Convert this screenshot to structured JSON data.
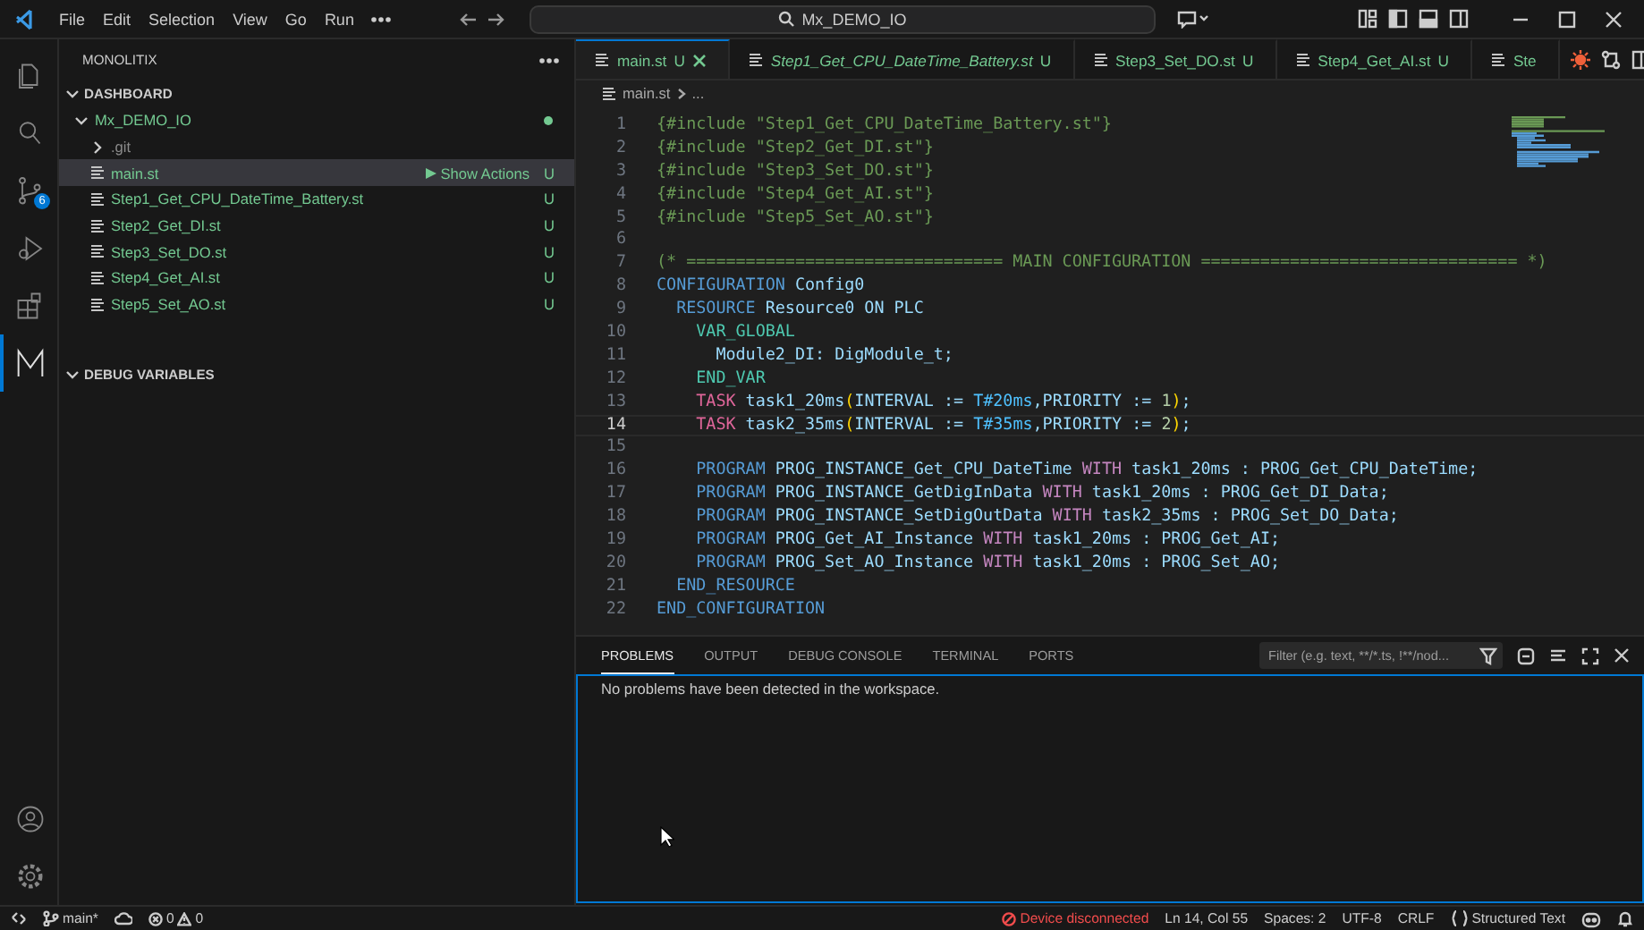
{
  "title_bar": {
    "menus": [
      "File",
      "Edit",
      "Selection",
      "View",
      "Go",
      "Run"
    ],
    "search": "Mx_DEMO_IO"
  },
  "activity_bar": {
    "items": [
      {
        "kind": "files",
        "selected": false
      },
      {
        "kind": "search",
        "selected": false
      },
      {
        "kind": "source-control",
        "selected": false,
        "badge": "6"
      },
      {
        "kind": "run",
        "selected": false
      },
      {
        "kind": "extensions",
        "selected": false
      },
      {
        "kind": "monolitix",
        "selected": true
      }
    ],
    "bottom": [
      {
        "kind": "account"
      },
      {
        "kind": "settings"
      }
    ]
  },
  "sidebar": {
    "title": "MONOLITIX",
    "sections": [
      {
        "title": "DASHBOARD",
        "expanded": true,
        "tree": [
          {
            "name": "Mx_DEMO_IO",
            "kind": "folder",
            "expanded": true,
            "selected": false,
            "dot": true,
            "children": [
              {
                "name": ".git",
                "kind": "folder",
                "expanded": false,
                "selected": false
              },
              {
                "name": "main.st",
                "kind": "file",
                "selected": true,
                "action": "Show Actions",
                "status": "U"
              },
              {
                "name": "Step1_Get_CPU_DateTime_Battery.st",
                "kind": "file",
                "selected": false,
                "status": "U"
              },
              {
                "name": "Step2_Get_DI.st",
                "kind": "file",
                "selected": false,
                "status": "U"
              },
              {
                "name": "Step3_Set_DO.st",
                "kind": "file",
                "selected": false,
                "status": "U"
              },
              {
                "name": "Step4_Get_AI.st",
                "kind": "file",
                "selected": false,
                "status": "U"
              },
              {
                "name": "Step5_Set_AO.st",
                "kind": "file",
                "selected": false,
                "status": "U"
              }
            ]
          }
        ]
      },
      {
        "title": "DEBUG VARIABLES",
        "expanded": true
      }
    ]
  },
  "editor": {
    "tabs": [
      {
        "label": "main.st",
        "status": "U",
        "selected": true,
        "preview": false
      },
      {
        "label": "Step1_Get_CPU_DateTime_Battery.st",
        "status": "U",
        "selected": false,
        "preview": true
      },
      {
        "label": "Step3_Set_DO.st",
        "status": "U",
        "selected": false,
        "preview": false
      },
      {
        "label": "Step4_Get_AI.st",
        "status": "U",
        "selected": false,
        "preview": false
      },
      {
        "label": "Ste",
        "selected": false,
        "preview": false
      }
    ],
    "breadcrumb": [
      "main.st",
      "..."
    ],
    "lines": [
      {
        "n": "1",
        "current": false,
        "tokens": [
          {
            "text": "{#include \"Step1_Get_CPU_DateTime_Battery.st\"}",
            "kind": "directive"
          }
        ]
      },
      {
        "n": "2",
        "current": false,
        "tokens": [
          {
            "text": "{#include \"Step2_Get_DI.st\"}",
            "kind": "directive"
          }
        ]
      },
      {
        "n": "3",
        "current": false,
        "tokens": [
          {
            "text": "{#include \"Step3_Set_DO.st\"}",
            "kind": "directive"
          }
        ]
      },
      {
        "n": "4",
        "current": false,
        "tokens": [
          {
            "text": "{#include \"Step4_Get_AI.st\"}",
            "kind": "directive"
          }
        ]
      },
      {
        "n": "5",
        "current": false,
        "tokens": [
          {
            "text": "{#include \"Step5_Set_AO.st\"}",
            "kind": "directive"
          }
        ]
      },
      {
        "n": "6",
        "current": false
      },
      {
        "n": "7",
        "current": false,
        "tokens": [
          {
            "text": "(* ================================ MAIN CONFIGURATION ================================ *)",
            "kind": "comment"
          }
        ]
      },
      {
        "n": "8",
        "current": false,
        "tokens": [
          {
            "text": "CONFIGURATION",
            "kind": "keyword"
          },
          {
            "text": " Config0",
            "kind": "ident"
          }
        ]
      },
      {
        "n": "9",
        "current": false,
        "tokens": [
          {
            "text": "  RESOURCE",
            "kind": "keyword"
          },
          {
            "text": " Resource0 ON PLC",
            "kind": "ident"
          }
        ]
      },
      {
        "n": "10",
        "current": false,
        "tokens": [
          {
            "text": "    VAR_GLOBAL",
            "kind": "block"
          }
        ]
      },
      {
        "n": "11",
        "current": false,
        "tokens": [
          {
            "text": "      Module2_DI: DigModule_t;",
            "kind": "ident"
          }
        ]
      },
      {
        "n": "12",
        "current": false,
        "tokens": [
          {
            "text": "    END_VAR",
            "kind": "block"
          }
        ]
      },
      {
        "n": "13",
        "current": false,
        "tokens": [
          {
            "text": "    TASK",
            "kind": "task"
          },
          {
            "text": " task1_20ms",
            "kind": "ident"
          },
          {
            "text": "(",
            "kind": "paren"
          },
          {
            "text": "INTERVAL := ",
            "kind": "ident"
          },
          {
            "text": "T#20ms",
            "kind": "time"
          },
          {
            "text": ",PRIORITY := ",
            "kind": "ident"
          },
          {
            "text": "1",
            "kind": "number"
          },
          {
            "text": ")",
            "kind": "paren"
          },
          {
            "text": ";",
            "kind": "ident"
          }
        ]
      },
      {
        "n": "14",
        "current": true,
        "tokens": [
          {
            "text": "    TASK",
            "kind": "task"
          },
          {
            "text": " task2_35ms",
            "kind": "ident"
          },
          {
            "text": "(",
            "kind": "paren"
          },
          {
            "text": "INTERVAL := ",
            "kind": "ident"
          },
          {
            "text": "T#35ms",
            "kind": "time"
          },
          {
            "text": ",PRIORITY := ",
            "kind": "ident"
          },
          {
            "text": "2",
            "kind": "number"
          },
          {
            "text": ")",
            "kind": "paren"
          },
          {
            "text": ";",
            "kind": "ident"
          }
        ]
      },
      {
        "n": "15",
        "current": false
      },
      {
        "n": "16",
        "current": false,
        "tokens": [
          {
            "text": "    PROGRAM",
            "kind": "keyword"
          },
          {
            "text": " PROG_INSTANCE_Get_CPU_DateTime ",
            "kind": "ident"
          },
          {
            "text": "WITH",
            "kind": "with"
          },
          {
            "text": " task1_20ms : PROG_Get_CPU_DateTime;",
            "kind": "ident"
          }
        ]
      },
      {
        "n": "17",
        "current": false,
        "tokens": [
          {
            "text": "    PROGRAM",
            "kind": "keyword"
          },
          {
            "text": " PROG_INSTANCE_GetDigInData ",
            "kind": "ident"
          },
          {
            "text": "WITH",
            "kind": "with"
          },
          {
            "text": " task1_20ms : PROG_Get_DI_Data;",
            "kind": "ident"
          }
        ]
      },
      {
        "n": "18",
        "current": false,
        "tokens": [
          {
            "text": "    PROGRAM",
            "kind": "keyword"
          },
          {
            "text": " PROG_INSTANCE_SetDigOutData ",
            "kind": "ident"
          },
          {
            "text": "WITH",
            "kind": "with"
          },
          {
            "text": " task2_35ms : PROG_Set_DO_Data;",
            "kind": "ident"
          }
        ]
      },
      {
        "n": "19",
        "current": false,
        "tokens": [
          {
            "text": "    PROGRAM",
            "kind": "keyword"
          },
          {
            "text": " PROG_Get_AI_Instance ",
            "kind": "ident"
          },
          {
            "text": "WITH",
            "kind": "with"
          },
          {
            "text": " task1_20ms : PROG_Get_AI;",
            "kind": "ident"
          }
        ]
      },
      {
        "n": "20",
        "current": false,
        "tokens": [
          {
            "text": "    PROGRAM",
            "kind": "keyword"
          },
          {
            "text": " PROG_Set_AO_Instance ",
            "kind": "ident"
          },
          {
            "text": "WITH",
            "kind": "with"
          },
          {
            "text": " task1_20ms : PROG_Set_AO;",
            "kind": "ident"
          }
        ]
      },
      {
        "n": "21",
        "current": false,
        "tokens": [
          {
            "text": "  END_RESOURCE",
            "kind": "keyword"
          }
        ]
      },
      {
        "n": "22",
        "current": false,
        "tokens": [
          {
            "text": "END_CONFIGURATION",
            "kind": "keyword"
          }
        ]
      }
    ]
  },
  "panel": {
    "tabs": [
      {
        "label": "PROBLEMS",
        "selected": true
      },
      {
        "label": "OUTPUT",
        "selected": false
      },
      {
        "label": "DEBUG CONSOLE",
        "selected": false
      },
      {
        "label": "TERMINAL",
        "selected": false
      },
      {
        "label": "PORTS",
        "selected": false
      }
    ],
    "filter": {
      "placeholder": "Filter (e.g. text, **/*.ts, !**/nod..."
    },
    "message": "No problems have been detected in the workspace."
  },
  "status_bar": {
    "branch": "main*",
    "errors": "0",
    "warnings": "0",
    "device": "Device disconnected",
    "position": "Ln 14, Col 55",
    "indentation": "Spaces: 2",
    "encoding": "UTF-8",
    "eol": "CRLF",
    "language": "Structured Text"
  }
}
